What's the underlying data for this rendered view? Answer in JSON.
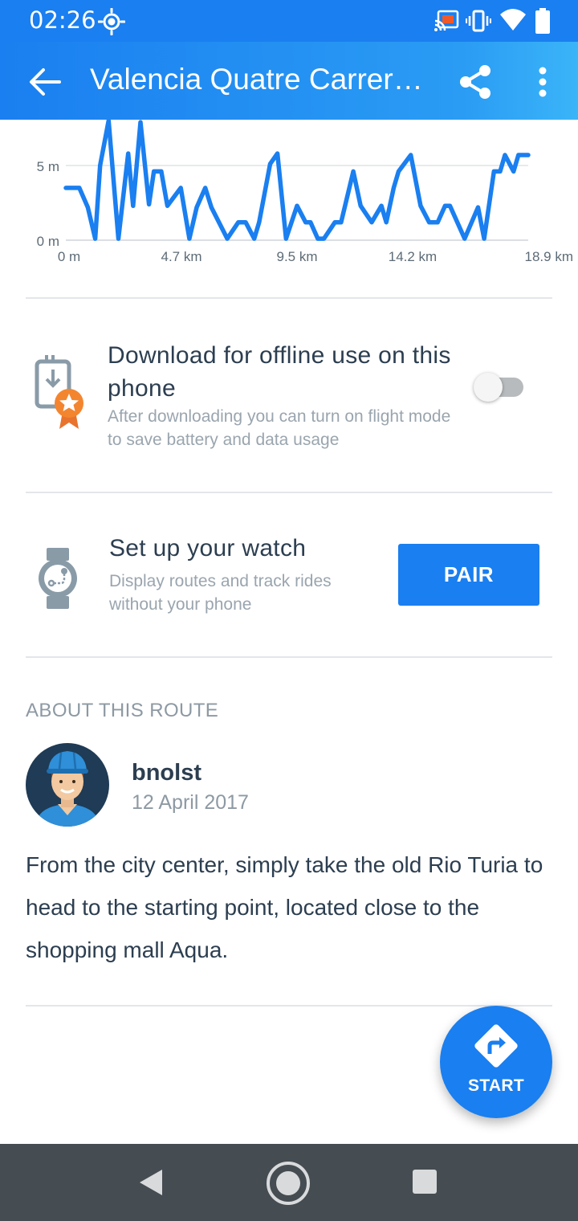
{
  "status_bar": {
    "time": "02:26",
    "icons": [
      "brightness-icon",
      "cast-icon",
      "vibrate-icon",
      "wifi-icon",
      "battery-icon"
    ]
  },
  "app_bar": {
    "title": "Valencia Quatre Carreres Circuit",
    "icons": [
      "back-arrow-icon",
      "share-icon",
      "more-vert-icon"
    ]
  },
  "chart_data": {
    "type": "line",
    "title": "",
    "xlabel": "",
    "ylabel": "",
    "x_tick_labels": [
      "0 m",
      "4.7 km",
      "9.5 km",
      "14.2 km",
      "18.9 km"
    ],
    "y_tick_labels": [
      "0 m",
      "5 m"
    ],
    "xlim": [
      0,
      18.9
    ],
    "ylim": [
      0,
      8
    ],
    "grid": true,
    "color": "#1a7ff0",
    "series": [
      {
        "x": [
          0,
          0.55,
          0.9,
          1.2,
          1.4,
          1.75,
          2.15,
          2.55,
          2.75,
          3.05,
          3.4,
          3.6,
          3.9,
          4.15,
          4.7,
          5.05,
          5.35,
          5.7,
          5.95,
          6.6,
          7.05,
          7.35,
          7.7,
          7.9,
          8.35,
          8.65,
          9.0,
          9.45,
          9.8,
          10.0,
          10.3,
          10.55,
          11.0,
          11.25,
          11.75,
          12.05,
          12.5,
          12.9,
          13.1,
          13.4,
          13.6,
          14.1,
          14.5,
          14.85,
          15.2,
          15.5,
          15.7,
          16.3,
          16.85,
          17.1,
          17.5,
          17.75,
          17.95,
          18.3,
          18.5,
          18.7,
          18.9
        ],
        "y": [
          3.5,
          3.5,
          2.2,
          0.1,
          5.0,
          8.0,
          0.1,
          5.8,
          2.3,
          7.9,
          2.4,
          4.6,
          4.6,
          2.3,
          3.5,
          0.1,
          2.2,
          3.5,
          2.2,
          0.1,
          1.2,
          1.2,
          0.1,
          1.2,
          5.1,
          5.8,
          0.1,
          2.3,
          1.2,
          1.2,
          0.1,
          0.1,
          1.2,
          1.2,
          4.6,
          2.3,
          1.2,
          2.3,
          1.2,
          3.5,
          4.6,
          5.7,
          2.3,
          1.2,
          1.2,
          2.3,
          2.3,
          0.1,
          2.2,
          0.1,
          4.6,
          4.6,
          5.7,
          4.6,
          5.7,
          5.7,
          5.7
        ]
      }
    ]
  },
  "offline": {
    "title": "Download for offline use on this phone",
    "subtitle": "After downloading you can turn on flight mode to save battery and data usage",
    "enabled": false
  },
  "watch": {
    "title": "Set up your watch",
    "subtitle": "Display routes and track rides without your phone",
    "button": "PAIR"
  },
  "about": {
    "header": "ABOUT THIS ROUTE",
    "author": "bnolst",
    "date": "12 April 2017",
    "description": "From the city center, simply take the old Rio Turia to head to the starting point, located close to the shopping mall Aqua."
  },
  "fab": {
    "label": "START"
  },
  "nav_bar": {
    "icons": [
      "nav-back-icon",
      "nav-home-icon",
      "nav-recents-icon"
    ]
  }
}
